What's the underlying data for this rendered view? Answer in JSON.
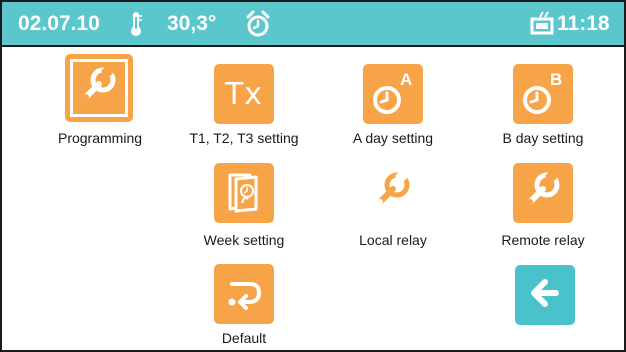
{
  "status_bar": {
    "date": "02.07.10",
    "temperature": "30,3°",
    "time": "11:18",
    "icons": [
      "thermometer-icon",
      "alarm-clock-icon",
      "window-timer-icon"
    ],
    "background_color": "#5bc6cc"
  },
  "menu": {
    "accent_color": "#f7a448",
    "items": [
      {
        "label": "Programming",
        "icon": "wrench-icon",
        "selected": true
      },
      {
        "label": "T1, T2, T3 setting",
        "icon": "tx-icon",
        "icon_text": "Tx"
      },
      {
        "label": "A day setting",
        "icon": "clock-a-icon",
        "icon_text": "A"
      },
      {
        "label": "B day setting",
        "icon": "clock-b-icon",
        "icon_text": "B"
      },
      {
        "label": "Week setting",
        "icon": "week-calendar-icon"
      },
      {
        "label": "Local relay",
        "icon": "wrench-icon"
      },
      {
        "label": "Remote relay",
        "icon": "wrench-icon"
      },
      {
        "label": "Default",
        "icon": "return-arrow-icon"
      }
    ]
  },
  "back_button": {
    "icon": "back-arrow-icon",
    "color": "#49c2cc"
  }
}
